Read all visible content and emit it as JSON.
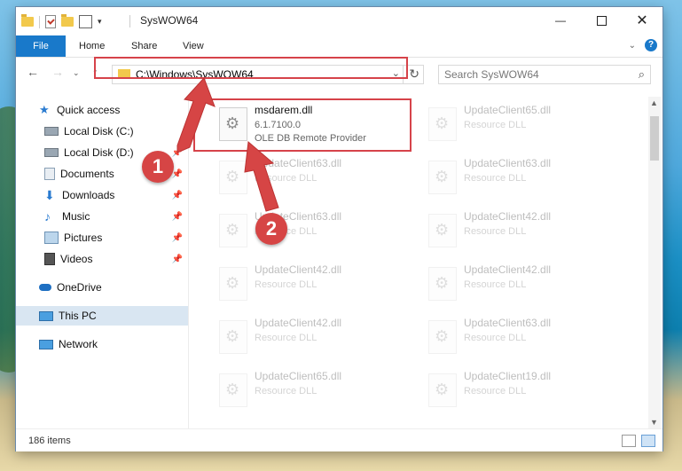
{
  "window": {
    "title": "SysWOW64"
  },
  "ribbon": {
    "tabs": [
      "File",
      "Home",
      "Share",
      "View"
    ]
  },
  "nav": {
    "address": "C:\\Windows\\SysWOW64",
    "search_placeholder": "Search SysWOW64"
  },
  "sidebar": {
    "items": [
      {
        "label": "Quick access",
        "icon": "star-icon"
      },
      {
        "label": "Local Disk (C:)",
        "icon": "drive-icon"
      },
      {
        "label": "Local Disk (D:)",
        "icon": "drive-icon"
      },
      {
        "label": "Documents",
        "icon": "documents-icon"
      },
      {
        "label": "Downloads",
        "icon": "download-icon"
      },
      {
        "label": "Music",
        "icon": "music-icon"
      },
      {
        "label": "Pictures",
        "icon": "pictures-icon"
      },
      {
        "label": "Videos",
        "icon": "videos-icon"
      },
      {
        "label": "OneDrive",
        "icon": "cloud-icon"
      },
      {
        "label": "This PC",
        "icon": "computer-icon"
      },
      {
        "label": "Network",
        "icon": "network-icon"
      }
    ]
  },
  "files": [
    {
      "name": "msdarem.dll",
      "version": "6.1.7100.0",
      "desc": "OLE DB Remote Provider"
    },
    {
      "name": "UpdateClient65.dll",
      "version": "Resource DLL",
      "desc": ""
    },
    {
      "name": "UpdateClient63.dll",
      "version": "Resource DLL",
      "desc": ""
    },
    {
      "name": "UpdateClient63.dll",
      "version": "Resource DLL",
      "desc": ""
    },
    {
      "name": "UpdateClient63.dll",
      "version": "Resource DLL",
      "desc": ""
    },
    {
      "name": "UpdateClient42.dll",
      "version": "Resource DLL",
      "desc": ""
    },
    {
      "name": "UpdateClient42.dll",
      "version": "Resource DLL",
      "desc": ""
    },
    {
      "name": "UpdateClient42.dll",
      "version": "Resource DLL",
      "desc": ""
    },
    {
      "name": "UpdateClient42.dll",
      "version": "Resource DLL",
      "desc": ""
    },
    {
      "name": "UpdateClient63.dll",
      "version": "Resource DLL",
      "desc": ""
    },
    {
      "name": "UpdateClient65.dll",
      "version": "Resource DLL",
      "desc": ""
    },
    {
      "name": "UpdateClient19.dll",
      "version": "Resource DLL",
      "desc": ""
    }
  ],
  "status": {
    "count": "186 items"
  },
  "annotations": {
    "badge1": "1",
    "badge2": "2",
    "color": "#d64545"
  }
}
